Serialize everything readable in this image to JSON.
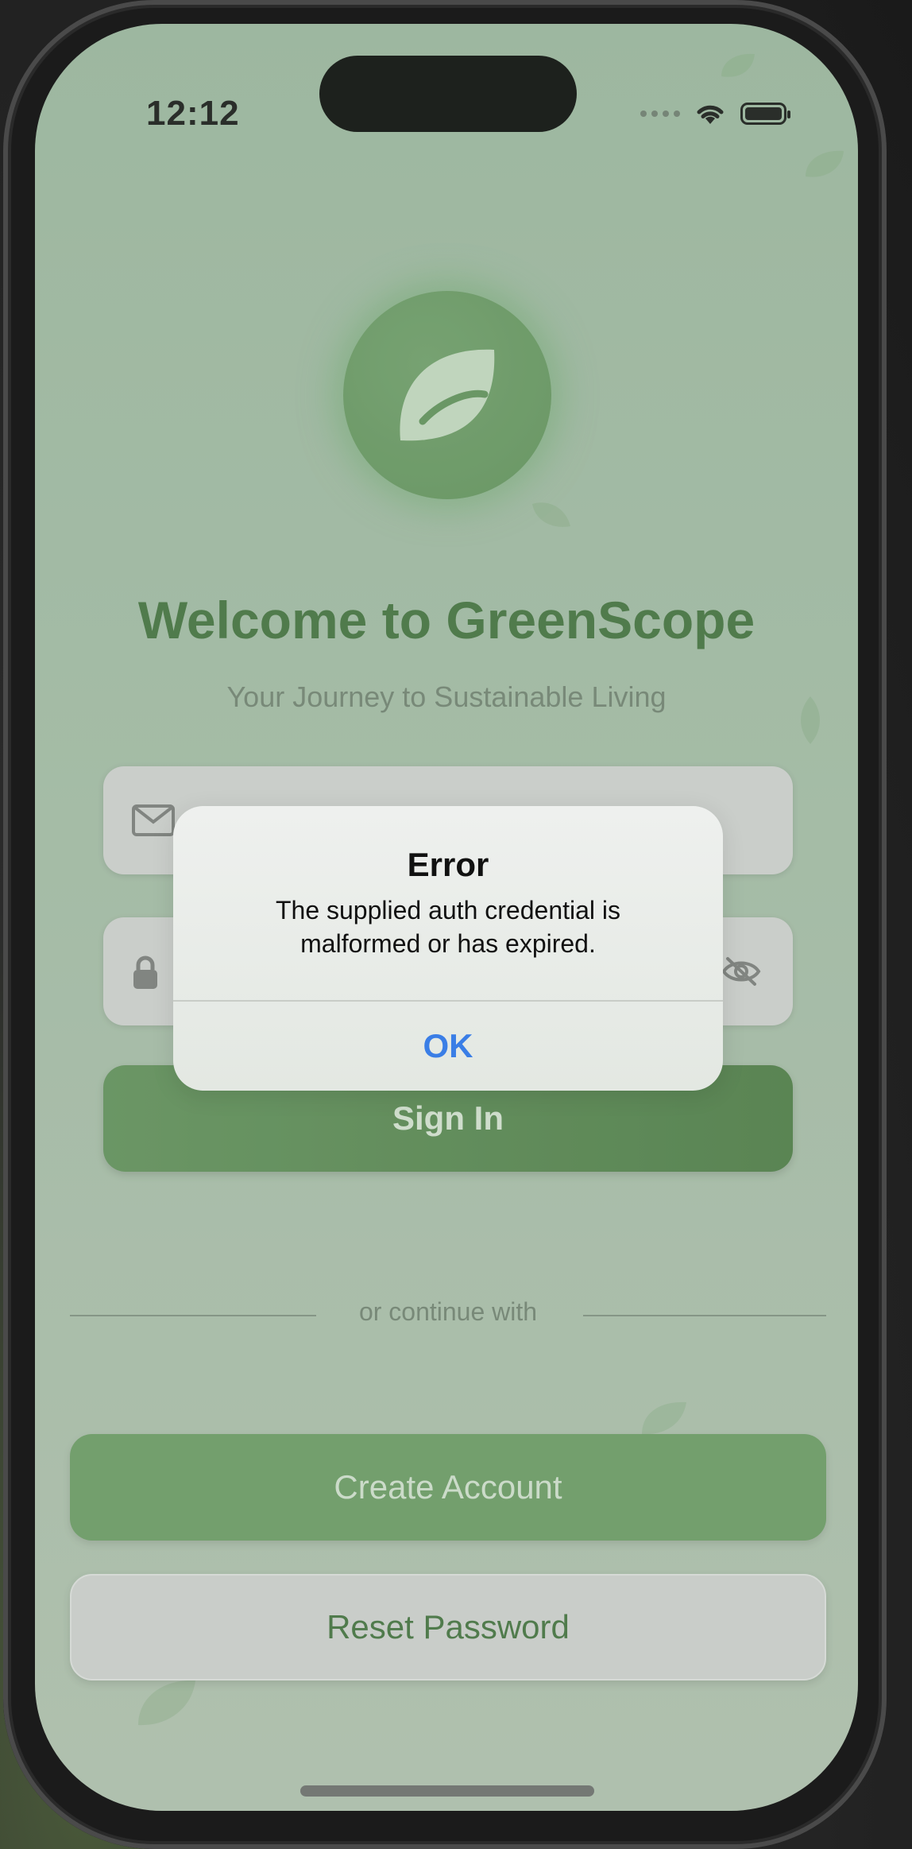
{
  "status_bar": {
    "time": "12:12",
    "icons": [
      "cellular-dots-icon",
      "wifi-icon",
      "battery-icon"
    ]
  },
  "header": {
    "title": "Welcome to GreenScope",
    "subtitle": "Your Journey to Sustainable Living"
  },
  "form": {
    "email": {
      "placeholder": "",
      "value": "",
      "icon": "envelope-icon"
    },
    "password": {
      "placeholder": "",
      "value": "",
      "icon": "lock-icon",
      "toggle_icon": "eye-slash-icon"
    },
    "sign_in_label": "Sign In"
  },
  "divider": {
    "label": "or continue with"
  },
  "actions": {
    "create_account_label": "Create Account",
    "reset_password_label": "Reset Password"
  },
  "alert": {
    "title": "Error",
    "message": "The supplied auth credential is malformed or has expired.",
    "ok_label": "OK"
  },
  "colors": {
    "brand_green": "#3f6e3a",
    "button_green": "#5f8f58",
    "alert_action_blue": "#3a7ee6"
  }
}
